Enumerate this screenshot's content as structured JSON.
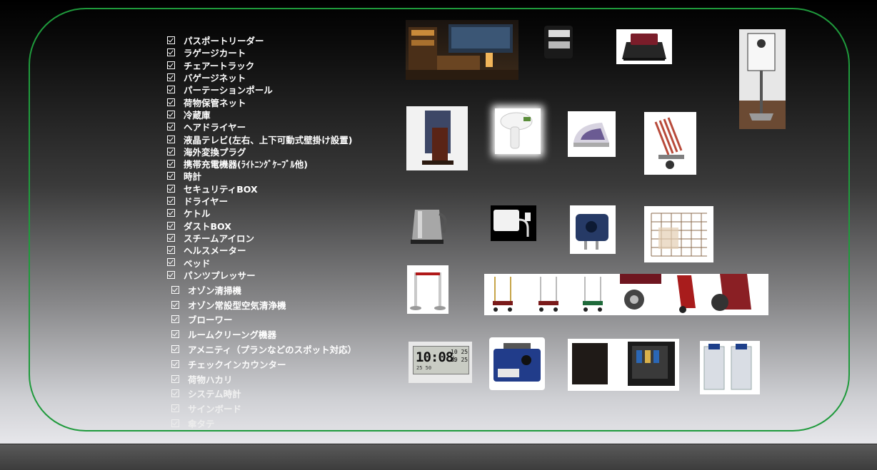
{
  "list_primary": [
    "パスポートリーダー",
    "ラゲージカート",
    "チェアートラック",
    "バゲージネット",
    "パーテーションポール",
    "荷物保管ネット",
    "冷蔵庫",
    "ヘアドライヤー",
    "液晶テレビ(左右、上下可動式壁掛け設置)",
    "海外変換プラグ",
    "携帯充電機器(ﾗｲﾄﾆﾝｸﾞｹｰﾌﾞﾙ他)",
    "時計",
    "セキュリティBOX",
    "ドライヤー",
    "ケトル",
    "ダストBOX",
    "スチームアイロン",
    "ヘルスメーター",
    "ベッド",
    "パンツプレッサー"
  ],
  "list_secondary": [
    "オゾン清掃機",
    "オゾン常設型空気清浄機",
    "ブローワー",
    "ルームクリーング機器",
    "アメニティ（プランなどのスポット対応）",
    "チェックインカウンター",
    "荷物ハカリ",
    "システム時計",
    "サインボード",
    "傘タテ"
  ],
  "clock_display": {
    "time": "10:08",
    "date": "10 25 土",
    "seconds": "59 25",
    "temp": "25 50"
  },
  "colors": {
    "frame": "#1f9a3c",
    "text_primary": "#ffffff"
  }
}
